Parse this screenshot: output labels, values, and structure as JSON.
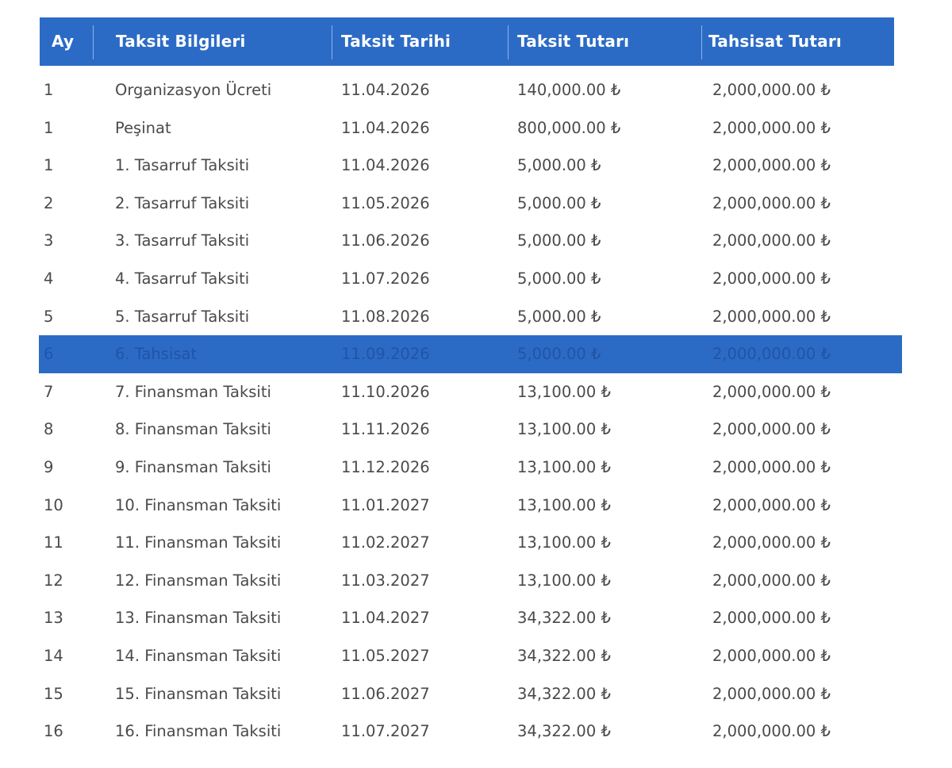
{
  "table": {
    "headers": [
      "Ay",
      "Taksit Bilgileri",
      "Taksit Tarihi",
      "Taksit Tutarı",
      "Tahsisat Tutarı"
    ],
    "accent_color": "#2b6bc6",
    "highlighted_row": 7,
    "rows": [
      {
        "ay": "1",
        "info": "Organizasyon Ücreti",
        "date": "11.04.2026",
        "amount": "140,000.00 ₺",
        "allocation": "2,000,000.00 ₺"
      },
      {
        "ay": "1",
        "info": "Peşinat",
        "date": "11.04.2026",
        "amount": "800,000.00 ₺",
        "allocation": "2,000,000.00 ₺"
      },
      {
        "ay": "1",
        "info": "1. Tasarruf Taksiti",
        "date": "11.04.2026",
        "amount": "5,000.00 ₺",
        "allocation": "2,000,000.00 ₺"
      },
      {
        "ay": "2",
        "info": "2. Tasarruf Taksiti",
        "date": "11.05.2026",
        "amount": "5,000.00 ₺",
        "allocation": "2,000,000.00 ₺"
      },
      {
        "ay": "3",
        "info": "3. Tasarruf Taksiti",
        "date": "11.06.2026",
        "amount": "5,000.00 ₺",
        "allocation": "2,000,000.00 ₺"
      },
      {
        "ay": "4",
        "info": "4. Tasarruf Taksiti",
        "date": "11.07.2026",
        "amount": "5,000.00 ₺",
        "allocation": "2,000,000.00 ₺"
      },
      {
        "ay": "5",
        "info": "5. Tasarruf Taksiti",
        "date": "11.08.2026",
        "amount": "5,000.00 ₺",
        "allocation": "2,000,000.00 ₺"
      },
      {
        "ay": "6",
        "info": "6. Tahsisat",
        "date": "11.09.2026",
        "amount": "5,000.00 ₺",
        "allocation": "2,000,000.00 ₺"
      },
      {
        "ay": "7",
        "info": "7. Finansman Taksiti",
        "date": "11.10.2026",
        "amount": "13,100.00 ₺",
        "allocation": "2,000,000.00 ₺"
      },
      {
        "ay": "8",
        "info": "8. Finansman Taksiti",
        "date": "11.11.2026",
        "amount": "13,100.00 ₺",
        "allocation": "2,000,000.00 ₺"
      },
      {
        "ay": "9",
        "info": "9. Finansman Taksiti",
        "date": "11.12.2026",
        "amount": "13,100.00 ₺",
        "allocation": "2,000,000.00 ₺"
      },
      {
        "ay": "10",
        "info": "10. Finansman Taksiti",
        "date": "11.01.2027",
        "amount": "13,100.00 ₺",
        "allocation": "2,000,000.00 ₺"
      },
      {
        "ay": "11",
        "info": "11. Finansman Taksiti",
        "date": "11.02.2027",
        "amount": "13,100.00 ₺",
        "allocation": "2,000,000.00 ₺"
      },
      {
        "ay": "12",
        "info": "12. Finansman Taksiti",
        "date": "11.03.2027",
        "amount": "13,100.00 ₺",
        "allocation": "2,000,000.00 ₺"
      },
      {
        "ay": "13",
        "info": "13. Finansman Taksiti",
        "date": "11.04.2027",
        "amount": "34,322.00 ₺",
        "allocation": "2,000,000.00 ₺"
      },
      {
        "ay": "14",
        "info": "14. Finansman Taksiti",
        "date": "11.05.2027",
        "amount": "34,322.00 ₺",
        "allocation": "2,000,000.00 ₺"
      },
      {
        "ay": "15",
        "info": "15. Finansman Taksiti",
        "date": "11.06.2027",
        "amount": "34,322.00 ₺",
        "allocation": "2,000,000.00 ₺"
      },
      {
        "ay": "16",
        "info": "16. Finansman Taksiti",
        "date": "11.07.2027",
        "amount": "34,322.00 ₺",
        "allocation": "2,000,000.00 ₺"
      }
    ]
  }
}
